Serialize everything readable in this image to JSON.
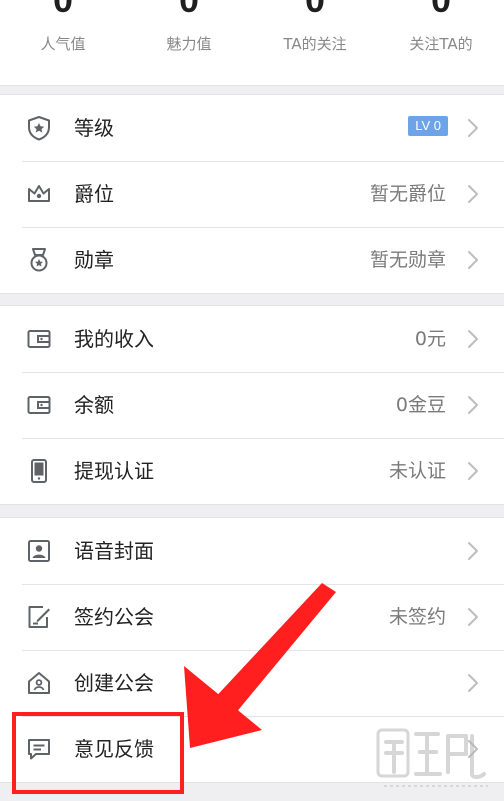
{
  "stats": [
    {
      "value": "0",
      "label": "人气值"
    },
    {
      "value": "0",
      "label": "魅力值"
    },
    {
      "value": "0",
      "label": "TA的关注"
    },
    {
      "value": "0",
      "label": "关注TA的"
    }
  ],
  "groups": [
    {
      "rows": [
        {
          "label": "等级",
          "value": "LV 0",
          "icon": "shield-star-icon"
        },
        {
          "label": "爵位",
          "value": "暂无爵位",
          "icon": "crown-icon"
        },
        {
          "label": "勋章",
          "value": "暂无勋章",
          "icon": "medal-icon"
        }
      ]
    },
    {
      "rows": [
        {
          "label": "我的收入",
          "value": "0元",
          "icon": "wallet-icon"
        },
        {
          "label": "余额",
          "value": "0金豆",
          "icon": "wallet-icon"
        },
        {
          "label": "提现认证",
          "value": "未认证",
          "icon": "phone-icon"
        }
      ]
    },
    {
      "rows": [
        {
          "label": "语音封面",
          "value": "",
          "icon": "portrait-icon"
        },
        {
          "label": "签约公会",
          "value": "未签约",
          "icon": "sign-icon"
        },
        {
          "label": "创建公会",
          "value": "",
          "icon": "house-icon"
        },
        {
          "label": "意见反馈",
          "value": "",
          "icon": "chat-bubble-icon"
        }
      ]
    }
  ],
  "colors": {
    "highlight": "#ff1f1f",
    "badge": "#6ea3e8"
  }
}
